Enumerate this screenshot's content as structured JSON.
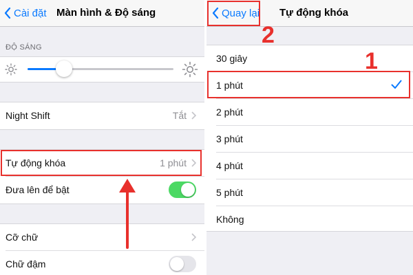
{
  "left": {
    "back_label": "Cài đặt",
    "title": "Màn hình & Độ sáng",
    "brightness_header": "ĐỘ SÁNG",
    "brightness_level": 0.25,
    "rows": {
      "night_shift": {
        "label": "Night Shift",
        "value": "Tắt"
      },
      "auto_lock": {
        "label": "Tự động khóa",
        "value": "1 phút"
      },
      "raise_to_wake": {
        "label": "Đưa lên để bật",
        "on": true
      },
      "text_size": {
        "label": "Cỡ chữ"
      },
      "bold_text": {
        "label": "Chữ đậm",
        "on": false
      }
    }
  },
  "right": {
    "back_label": "Quay lại",
    "title": "Tự động khóa",
    "options": [
      "30 giây",
      "1 phút",
      "2 phút",
      "3 phút",
      "4 phút",
      "5 phút",
      "Không"
    ],
    "selected": "1 phút"
  },
  "annotations": {
    "step_1": "1",
    "step_2": "2"
  },
  "colors": {
    "accent_blue": "#0a7aff",
    "toggle_green": "#4cd964",
    "annotation_red": "#e8302c"
  }
}
